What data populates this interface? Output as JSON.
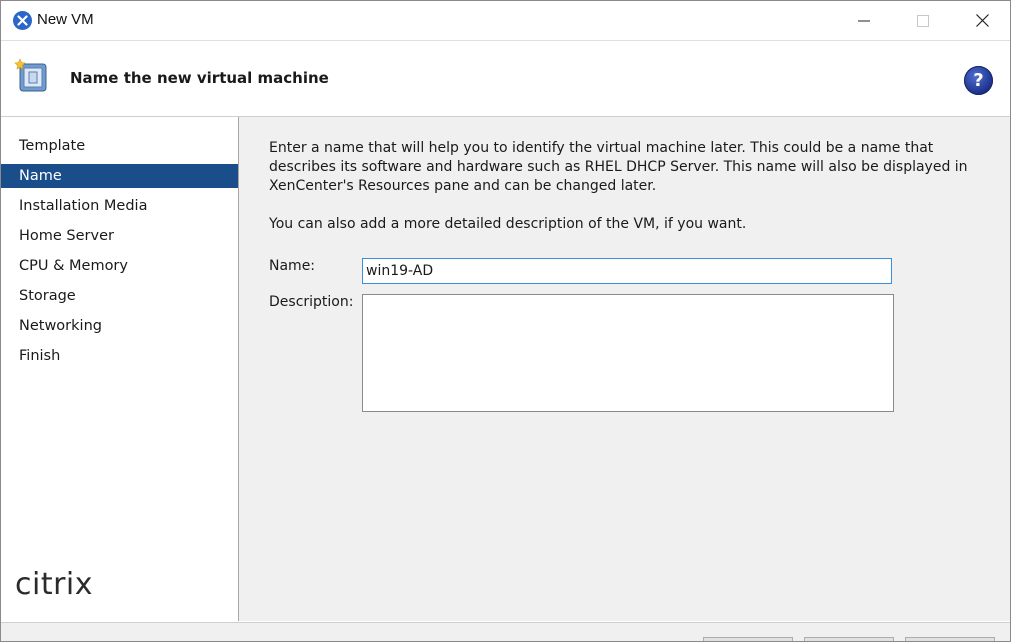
{
  "window": {
    "title": "New VM",
    "controls": {
      "minimize_icon": "minimize-icon",
      "maximize_icon": "maximize-icon",
      "close_icon": "close-icon"
    }
  },
  "header": {
    "title": "Name the new virtual machine",
    "help_label": "?"
  },
  "sidebar": {
    "items": [
      {
        "label": "Template",
        "active": false
      },
      {
        "label": "Name",
        "active": true
      },
      {
        "label": "Installation Media",
        "active": false
      },
      {
        "label": "Home Server",
        "active": false
      },
      {
        "label": "CPU & Memory",
        "active": false
      },
      {
        "label": "Storage",
        "active": false
      },
      {
        "label": "Networking",
        "active": false
      },
      {
        "label": "Finish",
        "active": false
      }
    ],
    "logo_text": "citrix"
  },
  "main": {
    "intro": "Enter a name that will help you to identify the virtual machine later. This could be a name that describes its software and hardware such as RHEL DHCP Server. This name will also be displayed in XenCenter's Resources pane and can be changed later.",
    "intro2": "You can also add a more detailed description of the VM, if you want.",
    "name_label": "Name:",
    "name_value": "win19-AD",
    "description_label": "Description:",
    "description_value": ""
  },
  "colors": {
    "active_nav_bg": "#1a4e8a",
    "input_focus_border": "#3b8fd9",
    "help_icon": "#1b2f8a",
    "app_icon": "#2a67c8"
  }
}
